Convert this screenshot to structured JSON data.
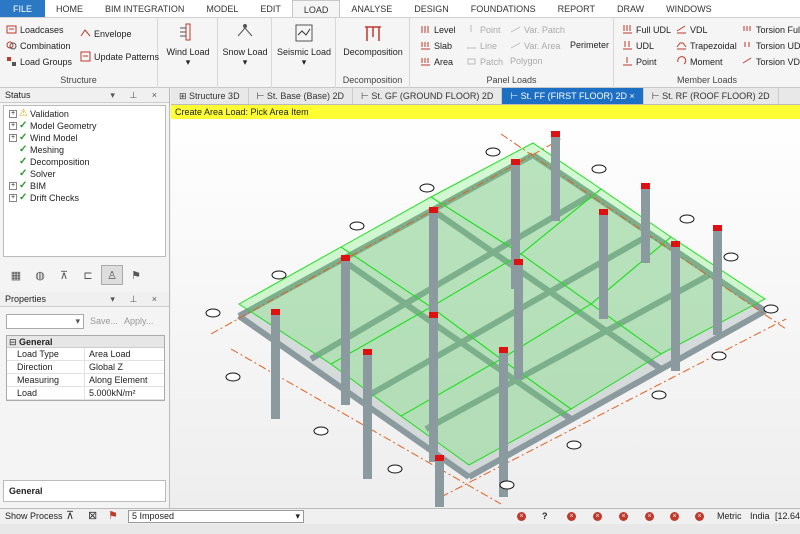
{
  "menu": [
    "FILE",
    "HOME",
    "BIM INTEGRATION",
    "MODEL",
    "EDIT",
    "LOAD",
    "ANALYSE",
    "DESIGN",
    "FOUNDATIONS",
    "REPORT",
    "DRAW",
    "WINDOWS"
  ],
  "ribbon": {
    "structure": {
      "loadcases": "Loadcases",
      "combination": "Combination",
      "load_groups": "Load Groups",
      "envelope": "Envelope",
      "update_patterns": "Update Patterns",
      "label": "Structure"
    },
    "wind_load": "Wind Load",
    "snow_load": "Snow Load",
    "seismic_load": "Seismic Load",
    "decomposition": {
      "button": "Decomposition",
      "label": "Decomposition"
    },
    "panel": {
      "level": "Level",
      "slab": "Slab",
      "area": "Area",
      "point": "Point",
      "line": "Line",
      "patch": "Patch",
      "var_patch": "Var. Patch",
      "var_area": "Var. Area",
      "polygon": "Polygon",
      "perimeter": "Perimeter",
      "label": "Panel Loads"
    },
    "member": {
      "full_udl": "Full UDL",
      "udl": "UDL",
      "point": "Point",
      "vdl": "VDL",
      "trapezoidal": "Trapezoidal",
      "moment": "Moment",
      "torsion_full": "Torsion Full",
      "torsion_udl": "Torsion UDL",
      "torsion_vdl": "Torsion VDL",
      "label": "Member Loads"
    }
  },
  "status": {
    "title": "Status",
    "items": [
      {
        "label": "Validation",
        "state": "warning"
      },
      {
        "label": "Model Geometry",
        "state": "ok"
      },
      {
        "label": "Wind Model",
        "state": "ok"
      },
      {
        "label": "Meshing",
        "state": "ok"
      },
      {
        "label": "Decomposition",
        "state": "ok"
      },
      {
        "label": "Solver",
        "state": "ok"
      },
      {
        "label": "BIM",
        "state": "ok"
      },
      {
        "label": "Drift Checks",
        "state": "ok"
      }
    ]
  },
  "properties": {
    "title": "Properties",
    "save": "Save...",
    "apply": "Apply...",
    "group": "General",
    "rows": [
      {
        "key": "Load Type",
        "value": "Area Load"
      },
      {
        "key": "Direction",
        "value": "Global Z"
      },
      {
        "key": "Measuring",
        "value": "Along Element"
      },
      {
        "key": "Load",
        "value": "5.000kN/m²"
      }
    ],
    "footer_group": "General"
  },
  "tabs": [
    "Structure 3D",
    "St. Base (Base) 2D",
    "St. GF (GROUND FLOOR) 2D",
    "St. FF (FIRST FLOOR) 2D",
    "St. RF (ROOF FLOOR) 2D"
  ],
  "active_tab": "St. FF (FIRST FLOOR) 2D",
  "command_prompt": "Create Area Load: Pick Area Item",
  "statusbar": {
    "show_process": "Show Process",
    "loadcase": "5 Imposed",
    "units": "Metric",
    "region": "India",
    "coord": "[12.64"
  },
  "colors": {
    "accent": "#1d6fc4",
    "prompt": "#ffff33",
    "load_green": "#22dd22",
    "column_red": "#dd1111"
  }
}
